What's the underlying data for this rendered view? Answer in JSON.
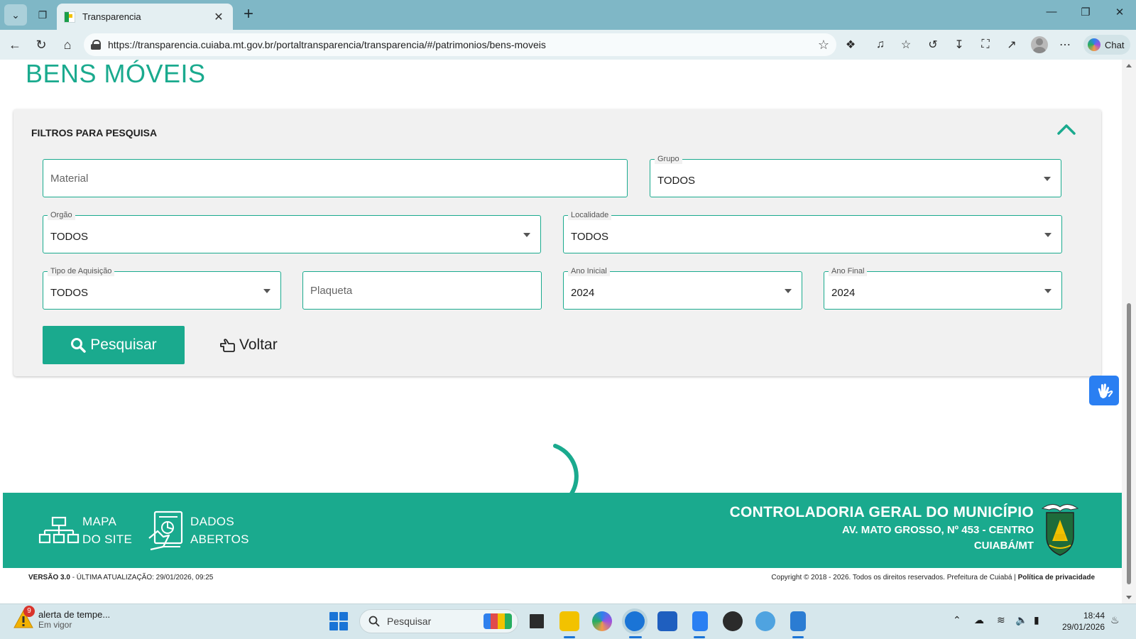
{
  "browser": {
    "tab_title": "Transparencia",
    "url": "https://transparencia.cuiaba.mt.gov.br/portaltransparencia/transparencia/#/patrimonios/bens-moveis",
    "chat_label": "Chat"
  },
  "page": {
    "title": "BENS MÓVEIS",
    "filters": {
      "heading": "FILTROS PARA PESQUISA",
      "material_placeholder": "Material",
      "grupo": {
        "label": "Grupo",
        "value": "TODOS"
      },
      "orgao": {
        "label": "Orgão",
        "value": "TODOS"
      },
      "localidade": {
        "label": "Localidade",
        "value": "TODOS"
      },
      "tipo_aquisicao": {
        "label": "Tipo de Aquisição",
        "value": "TODOS"
      },
      "plaqueta_placeholder": "Plaqueta",
      "ano_inicial": {
        "label": "Ano Inicial",
        "value": "2024"
      },
      "ano_final": {
        "label": "Ano Final",
        "value": "2024"
      },
      "search_button": "Pesquisar",
      "back_button": "Voltar"
    }
  },
  "footer": {
    "site_map_line1": "MAPA",
    "site_map_line2": "DO SITE",
    "open_data_line1": "DADOS",
    "open_data_line2": "ABERTOS",
    "org_name": "CONTROLADORIA GERAL DO MUNICÍPIO",
    "address": "AV. MATO GROSSO, Nº 453 - CENTRO",
    "city": "CUIABÁ/MT",
    "version_bold": "VERSÃO 3.0",
    "version_rest": " - ÚLTIMA ATUALIZAÇÃO: 29/01/2026, 09:25",
    "copyright": "Copyright © 2018 - 2026. Todos os direitos reservados. Prefeitura de Cuiabá | ",
    "privacy": "Política de privacidade"
  },
  "taskbar": {
    "weather_badge": "9",
    "weather_title": "alerta de tempe...",
    "weather_sub": "Em vigor",
    "search_placeholder": "Pesquisar",
    "time": "18:44",
    "date": "29/01/2026"
  },
  "colors": {
    "brand": "#1aaa8e",
    "accessibility": "#2a7ff2"
  }
}
